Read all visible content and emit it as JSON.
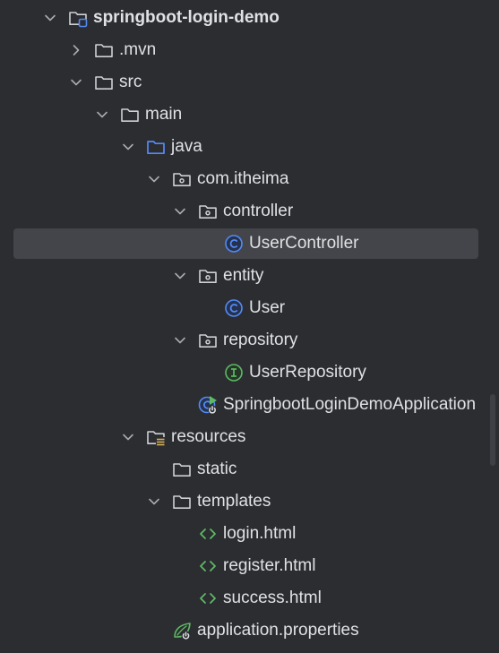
{
  "project_tree": {
    "items": [
      {
        "label": "springboot-login-demo",
        "bold": true,
        "depth": 0,
        "chevron": "down",
        "icon": "module-folder-icon"
      },
      {
        "label": ".mvn",
        "bold": false,
        "depth": 1,
        "chevron": "right",
        "icon": "folder-icon"
      },
      {
        "label": "src",
        "bold": false,
        "depth": 1,
        "chevron": "down",
        "icon": "folder-icon"
      },
      {
        "label": "main",
        "bold": false,
        "depth": 2,
        "chevron": "down",
        "icon": "folder-icon"
      },
      {
        "label": "java",
        "bold": false,
        "depth": 3,
        "chevron": "down",
        "icon": "source-folder-icon"
      },
      {
        "label": "com.itheima",
        "bold": false,
        "depth": 4,
        "chevron": "down",
        "icon": "package-icon"
      },
      {
        "label": "controller",
        "bold": false,
        "depth": 5,
        "chevron": "down",
        "icon": "package-icon"
      },
      {
        "label": "UserController",
        "bold": false,
        "depth": 6,
        "chevron": "none",
        "icon": "class-icon",
        "selected": true
      },
      {
        "label": "entity",
        "bold": false,
        "depth": 5,
        "chevron": "down",
        "icon": "package-icon"
      },
      {
        "label": "User",
        "bold": false,
        "depth": 6,
        "chevron": "none",
        "icon": "class-icon"
      },
      {
        "label": "repository",
        "bold": false,
        "depth": 5,
        "chevron": "down",
        "icon": "package-icon"
      },
      {
        "label": "UserRepository",
        "bold": false,
        "depth": 6,
        "chevron": "none",
        "icon": "interface-icon"
      },
      {
        "label": "SpringbootLoginDemoApplication",
        "bold": false,
        "depth": 5,
        "chevron": "none",
        "icon": "spring-boot-class-icon"
      },
      {
        "label": "resources",
        "bold": false,
        "depth": 3,
        "chevron": "down",
        "icon": "resources-folder-icon"
      },
      {
        "label": "static",
        "bold": false,
        "depth": 4,
        "chevron": "none",
        "icon": "folder-icon"
      },
      {
        "label": "templates",
        "bold": false,
        "depth": 4,
        "chevron": "down",
        "icon": "folder-icon"
      },
      {
        "label": "login.html",
        "bold": false,
        "depth": 5,
        "chevron": "none",
        "icon": "html-file-icon"
      },
      {
        "label": "register.html",
        "bold": false,
        "depth": 5,
        "chevron": "none",
        "icon": "html-file-icon"
      },
      {
        "label": "success.html",
        "bold": false,
        "depth": 5,
        "chevron": "none",
        "icon": "html-file-icon"
      },
      {
        "label": "application.properties",
        "bold": false,
        "depth": 4,
        "chevron": "none",
        "icon": "spring-properties-icon"
      }
    ]
  },
  "colors": {
    "background": "#2b2d30",
    "text": "#dfe1e5",
    "selection": "#43454a",
    "chevron": "#a8abb0",
    "folder": "#ced0d6",
    "source_folder": "#548af7",
    "class_icon": "#548af7",
    "interface_icon": "#5fb865",
    "html_icon": "#5fb865",
    "spring": "#5fb865"
  }
}
